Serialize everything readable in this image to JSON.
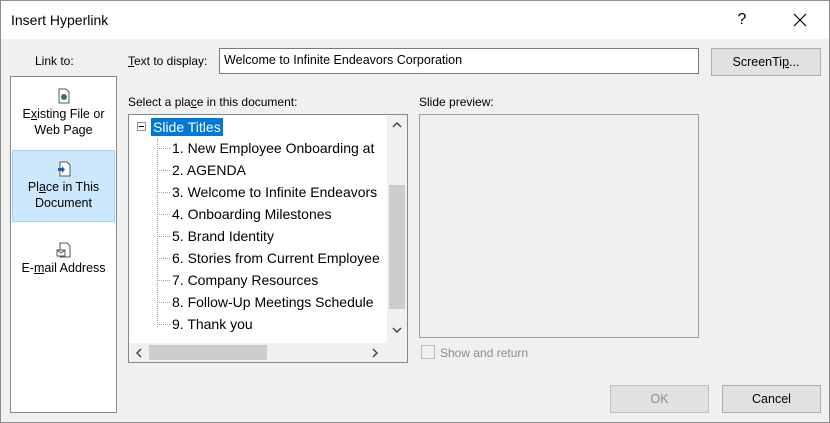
{
  "window": {
    "title": "Insert Hyperlink",
    "help_label": "?",
    "close_label": "close"
  },
  "link_to": {
    "label_pre": "",
    "label": "Link to:",
    "items": [
      {
        "label_line1_pre": "E",
        "label_line1_u": "x",
        "label_line1_post": "isting File or",
        "label_line2": "Web Page",
        "icon": "file-icon",
        "selected": false
      },
      {
        "label_line1_pre": "Pl",
        "label_line1_u": "a",
        "label_line1_post": "ce in This",
        "label_line2": "Document",
        "icon": "document-place-icon",
        "selected": true
      },
      {
        "label_line1_pre": "E-",
        "label_line1_u": "m",
        "label_line1_post": "ail Address",
        "label_line2": "",
        "icon": "email-icon",
        "selected": false
      }
    ]
  },
  "text_to_display": {
    "label_u": "T",
    "label_rest": "ext to display:",
    "value": "Welcome to Infinite Endeavors Corporation"
  },
  "screentip": {
    "label_pre": "ScreenTi",
    "label_u": "p",
    "label_post": "..."
  },
  "place": {
    "label_pre": "Select a pla",
    "label_u": "c",
    "label_post": "e in this document:",
    "root": "Slide Titles",
    "items": [
      "1. New Employee Onboarding at",
      "2. AGENDA",
      "3. Welcome to Infinite Endeavors",
      "4. Onboarding Milestones",
      "5. Brand Identity",
      "6. Stories from Current Employee",
      "7. Company Resources",
      "8. Follow-Up Meetings Schedule",
      "9. Thank you"
    ]
  },
  "preview": {
    "label": "Slide preview:",
    "show_return_label": "Show and return"
  },
  "buttons": {
    "ok": "OK",
    "cancel": "Cancel"
  },
  "colors": {
    "selection": "#0078d7",
    "sidebar_selected": "#cce8ff"
  }
}
